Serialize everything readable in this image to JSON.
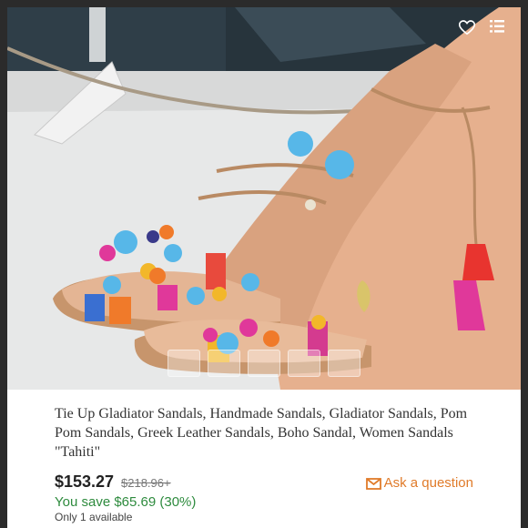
{
  "listing": {
    "title": "Tie Up Gladiator Sandals, Handmade Sandals, Gladiator Sandals, Pom Pom Sandals, Greek Leather Sandals, Boho Sandal, Women Sandals \"Tahiti\"",
    "price": "$153.27",
    "original_price": "$218.96+",
    "savings": "You save $65.69 (30%)",
    "availability": "Only 1 available",
    "ask_label": "Ask a question"
  },
  "icons": {
    "favorite": "heart-icon",
    "menu": "menu-list-icon",
    "ask": "mail-icon"
  },
  "colors": {
    "accent": "#e07b2a",
    "savings": "#2e8b3e",
    "price": "#222222",
    "title": "#333333"
  }
}
